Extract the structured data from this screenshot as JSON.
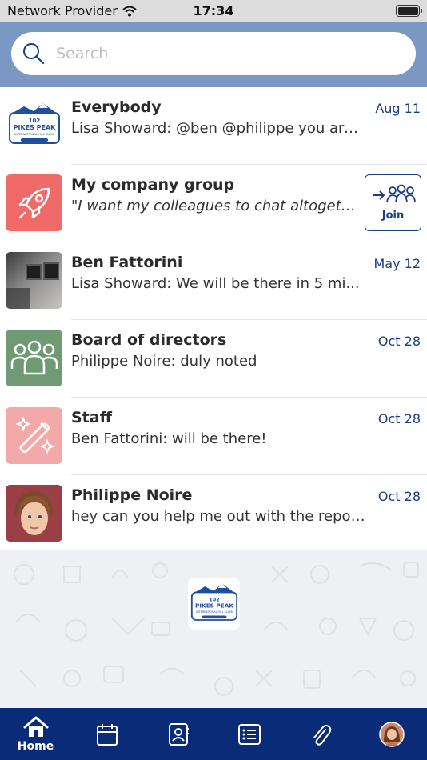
{
  "status_bar": {
    "carrier": "Network Provider",
    "time": "17:34"
  },
  "search": {
    "placeholder": "Search"
  },
  "chats": [
    {
      "name": "Everybody",
      "message": "Lisa Showard: @ben @philippe you are g...",
      "date": "Aug 11",
      "avatar": "pikes-peak-logo"
    },
    {
      "name": "My company group",
      "message": "\"I want my colleagues to chat altogeth...",
      "date": "",
      "avatar": "rocket-icon",
      "join_label": "Join"
    },
    {
      "name": "Ben Fattorini",
      "message": "Lisa Showard: We will be there in 5 mi...",
      "date": "May 12",
      "avatar": "photo"
    },
    {
      "name": "Board of directors",
      "message": "Philippe Noire: duly noted",
      "date": "Oct 28",
      "avatar": "group-icon"
    },
    {
      "name": "Staff",
      "message": "Ben Fattorini: will be there!",
      "date": "Oct 28",
      "avatar": "magic-wand-icon"
    },
    {
      "name": "Philippe Noire",
      "message": "hey can you help me out with the report?",
      "date": "Oct 28",
      "avatar": "photo"
    }
  ],
  "logo": {
    "line1": "102",
    "line2": "PIKES PEAK",
    "line3": "INTERNATIONAL HILL CLIMB"
  },
  "tab_bar": {
    "home_label": "Home"
  },
  "colors": {
    "header": "#7b97c4",
    "accent": "#1b3d86",
    "tab_bar": "#0a2b78",
    "rocket_bg": "#f06a6a",
    "group_bg": "#6f9a74",
    "staff_bg": "#f3a9aa"
  }
}
